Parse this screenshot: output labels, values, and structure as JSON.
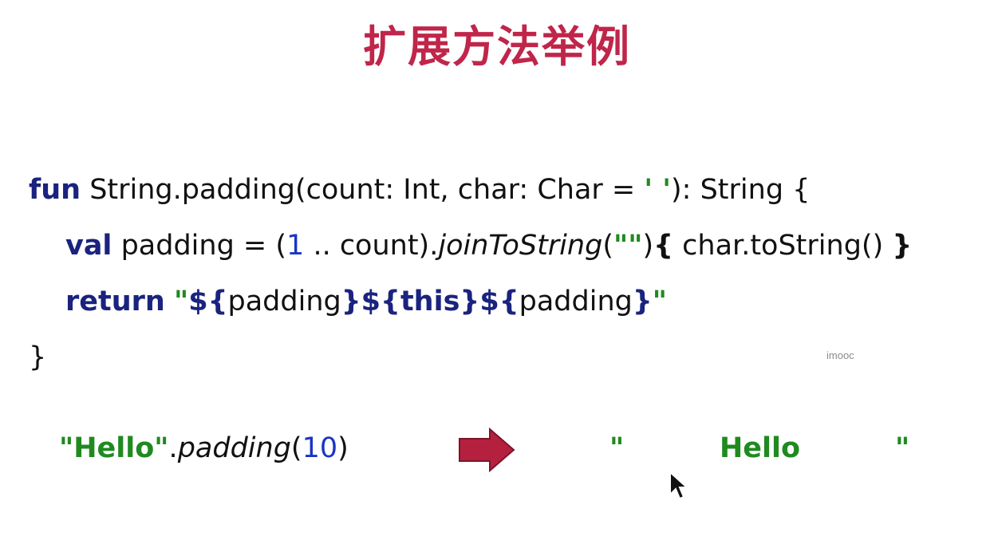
{
  "slide": {
    "title": "扩展方法举例",
    "watermark": "imooc"
  },
  "code": {
    "line1": {
      "kw_fun": "fun",
      "text": " String.padding(count: Int, char: Char = ",
      "char_literal": "' '",
      "tail": "): String {"
    },
    "line2": {
      "kw_val": "val",
      "text": " padding = (",
      "num": "1",
      "range": " .. count).",
      "method": "joinToString",
      "paren_open": "(",
      "str": "\"\"",
      "paren_close": ")",
      "brace_open": "{",
      "body": " char.toString() ",
      "brace_close": "}"
    },
    "line3": {
      "kw_return": "return",
      "space": " ",
      "q_open": "\"",
      "t1_open": "${",
      "t1_var": "padding",
      "t1_close": "}",
      "t2_open": "${",
      "t2_var": "this",
      "t2_close": "}",
      "t3_open": "${",
      "t3_var": "padding",
      "t3_close": "}",
      "q_close": "\""
    },
    "line4": {
      "brace": "}"
    }
  },
  "example": {
    "call_str": "\"Hello\"",
    "dot": ".",
    "call_method": "padding",
    "paren_open": "(",
    "arg": "10",
    "paren_close": ")",
    "arrow_icon": "right-arrow-icon",
    "result_quote_open": "\"",
    "result_word": "Hello",
    "result_quote_close": "\""
  },
  "colors": {
    "title": "#c0254a",
    "keyword": "#1a237e",
    "number": "#1a35c4",
    "string": "#1f8a1f",
    "arrow": "#b5203f"
  }
}
